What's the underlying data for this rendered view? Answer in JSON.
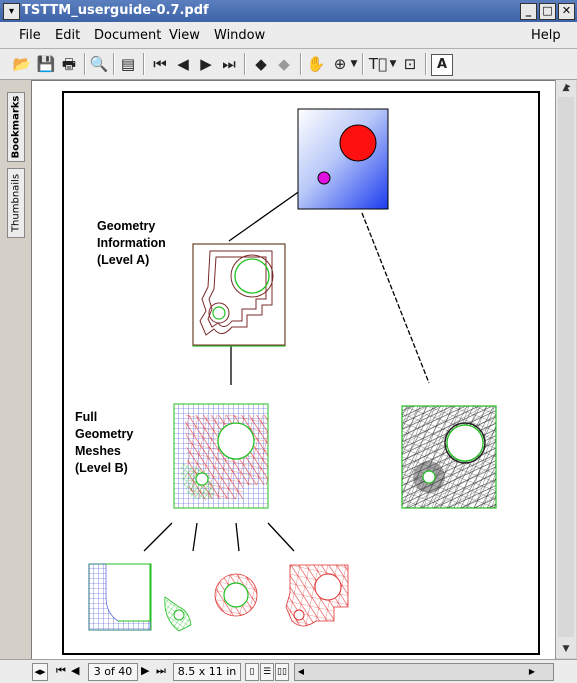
{
  "window": {
    "title": "TSTTM_userguide-0.7.pdf",
    "buttons": [
      "minimize-icon",
      "maximize-icon",
      "close-icon"
    ]
  },
  "menubar": {
    "items": [
      {
        "label": "File"
      },
      {
        "label": "Edit"
      },
      {
        "label": "Document"
      },
      {
        "label": "View"
      },
      {
        "label": "Window"
      },
      {
        "label": "Help"
      }
    ]
  },
  "sidebar": {
    "tabs": [
      {
        "label": "Bookmarks"
      },
      {
        "label": "Thumbnails"
      }
    ]
  },
  "figure": {
    "label_a": "Geometry\nInformation\n(Level A)",
    "label_b": "Full\nGeometry\nMeshes\n(Level B)"
  },
  "statusbar": {
    "page_indicator": "3 of 40",
    "page_size": "8.5 x 11 in"
  },
  "colors": {
    "mesh_red": "#e03030",
    "mesh_green": "#20c020",
    "mesh_blue": "#3040d0",
    "circle_red": "#ff1010",
    "circle_magenta": "#e010e0"
  }
}
